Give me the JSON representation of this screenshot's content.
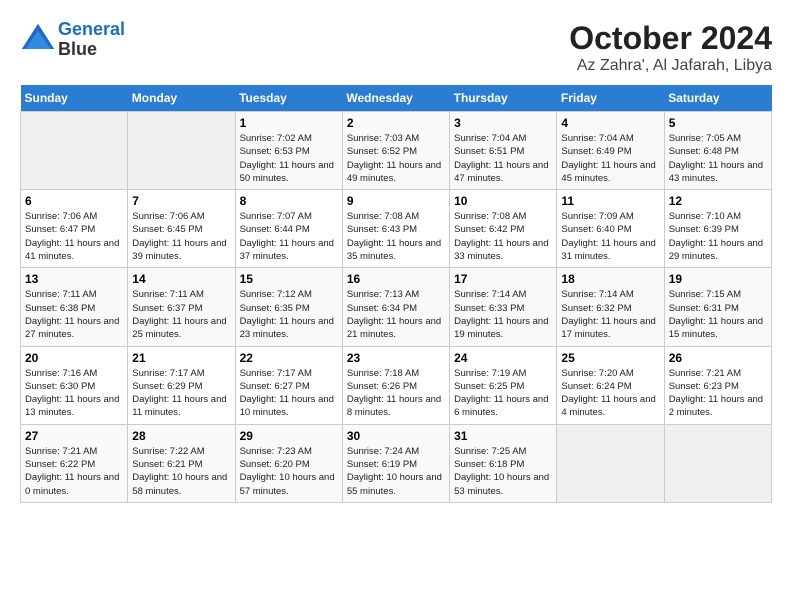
{
  "header": {
    "logo_line1": "General",
    "logo_line2": "Blue",
    "month": "October 2024",
    "location": "Az Zahra', Al Jafarah, Libya"
  },
  "weekdays": [
    "Sunday",
    "Monday",
    "Tuesday",
    "Wednesday",
    "Thursday",
    "Friday",
    "Saturday"
  ],
  "weeks": [
    [
      {
        "day": "",
        "empty": true
      },
      {
        "day": "",
        "empty": true
      },
      {
        "day": "1",
        "sunrise": "7:02 AM",
        "sunset": "6:53 PM",
        "daylight": "11 hours and 50 minutes."
      },
      {
        "day": "2",
        "sunrise": "7:03 AM",
        "sunset": "6:52 PM",
        "daylight": "11 hours and 49 minutes."
      },
      {
        "day": "3",
        "sunrise": "7:04 AM",
        "sunset": "6:51 PM",
        "daylight": "11 hours and 47 minutes."
      },
      {
        "day": "4",
        "sunrise": "7:04 AM",
        "sunset": "6:49 PM",
        "daylight": "11 hours and 45 minutes."
      },
      {
        "day": "5",
        "sunrise": "7:05 AM",
        "sunset": "6:48 PM",
        "daylight": "11 hours and 43 minutes."
      }
    ],
    [
      {
        "day": "6",
        "sunrise": "7:06 AM",
        "sunset": "6:47 PM",
        "daylight": "11 hours and 41 minutes."
      },
      {
        "day": "7",
        "sunrise": "7:06 AM",
        "sunset": "6:45 PM",
        "daylight": "11 hours and 39 minutes."
      },
      {
        "day": "8",
        "sunrise": "7:07 AM",
        "sunset": "6:44 PM",
        "daylight": "11 hours and 37 minutes."
      },
      {
        "day": "9",
        "sunrise": "7:08 AM",
        "sunset": "6:43 PM",
        "daylight": "11 hours and 35 minutes."
      },
      {
        "day": "10",
        "sunrise": "7:08 AM",
        "sunset": "6:42 PM",
        "daylight": "11 hours and 33 minutes."
      },
      {
        "day": "11",
        "sunrise": "7:09 AM",
        "sunset": "6:40 PM",
        "daylight": "11 hours and 31 minutes."
      },
      {
        "day": "12",
        "sunrise": "7:10 AM",
        "sunset": "6:39 PM",
        "daylight": "11 hours and 29 minutes."
      }
    ],
    [
      {
        "day": "13",
        "sunrise": "7:11 AM",
        "sunset": "6:38 PM",
        "daylight": "11 hours and 27 minutes."
      },
      {
        "day": "14",
        "sunrise": "7:11 AM",
        "sunset": "6:37 PM",
        "daylight": "11 hours and 25 minutes."
      },
      {
        "day": "15",
        "sunrise": "7:12 AM",
        "sunset": "6:35 PM",
        "daylight": "11 hours and 23 minutes."
      },
      {
        "day": "16",
        "sunrise": "7:13 AM",
        "sunset": "6:34 PM",
        "daylight": "11 hours and 21 minutes."
      },
      {
        "day": "17",
        "sunrise": "7:14 AM",
        "sunset": "6:33 PM",
        "daylight": "11 hours and 19 minutes."
      },
      {
        "day": "18",
        "sunrise": "7:14 AM",
        "sunset": "6:32 PM",
        "daylight": "11 hours and 17 minutes."
      },
      {
        "day": "19",
        "sunrise": "7:15 AM",
        "sunset": "6:31 PM",
        "daylight": "11 hours and 15 minutes."
      }
    ],
    [
      {
        "day": "20",
        "sunrise": "7:16 AM",
        "sunset": "6:30 PM",
        "daylight": "11 hours and 13 minutes."
      },
      {
        "day": "21",
        "sunrise": "7:17 AM",
        "sunset": "6:29 PM",
        "daylight": "11 hours and 11 minutes."
      },
      {
        "day": "22",
        "sunrise": "7:17 AM",
        "sunset": "6:27 PM",
        "daylight": "11 hours and 10 minutes."
      },
      {
        "day": "23",
        "sunrise": "7:18 AM",
        "sunset": "6:26 PM",
        "daylight": "11 hours and 8 minutes."
      },
      {
        "day": "24",
        "sunrise": "7:19 AM",
        "sunset": "6:25 PM",
        "daylight": "11 hours and 6 minutes."
      },
      {
        "day": "25",
        "sunrise": "7:20 AM",
        "sunset": "6:24 PM",
        "daylight": "11 hours and 4 minutes."
      },
      {
        "day": "26",
        "sunrise": "7:21 AM",
        "sunset": "6:23 PM",
        "daylight": "11 hours and 2 minutes."
      }
    ],
    [
      {
        "day": "27",
        "sunrise": "7:21 AM",
        "sunset": "6:22 PM",
        "daylight": "11 hours and 0 minutes."
      },
      {
        "day": "28",
        "sunrise": "7:22 AM",
        "sunset": "6:21 PM",
        "daylight": "10 hours and 58 minutes."
      },
      {
        "day": "29",
        "sunrise": "7:23 AM",
        "sunset": "6:20 PM",
        "daylight": "10 hours and 57 minutes."
      },
      {
        "day": "30",
        "sunrise": "7:24 AM",
        "sunset": "6:19 PM",
        "daylight": "10 hours and 55 minutes."
      },
      {
        "day": "31",
        "sunrise": "7:25 AM",
        "sunset": "6:18 PM",
        "daylight": "10 hours and 53 minutes."
      },
      {
        "day": "",
        "empty": true
      },
      {
        "day": "",
        "empty": true
      }
    ]
  ]
}
